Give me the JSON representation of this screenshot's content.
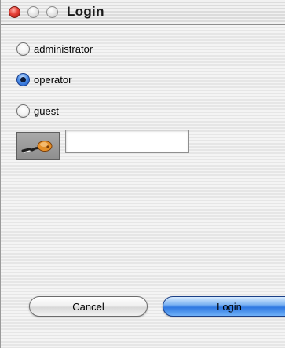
{
  "window": {
    "title": "Login"
  },
  "roles": {
    "items": [
      {
        "label": "administrator",
        "checked": false
      },
      {
        "label": "operator",
        "checked": true
      },
      {
        "label": "guest",
        "checked": false
      }
    ]
  },
  "key_field": {
    "value": "",
    "icon": "key-icon"
  },
  "buttons": {
    "cancel_label": "Cancel",
    "login_label": "Login"
  },
  "colors": {
    "close_light": "#e8433a",
    "selected_radio": "#1553c4",
    "default_button": "#2f78e2"
  }
}
